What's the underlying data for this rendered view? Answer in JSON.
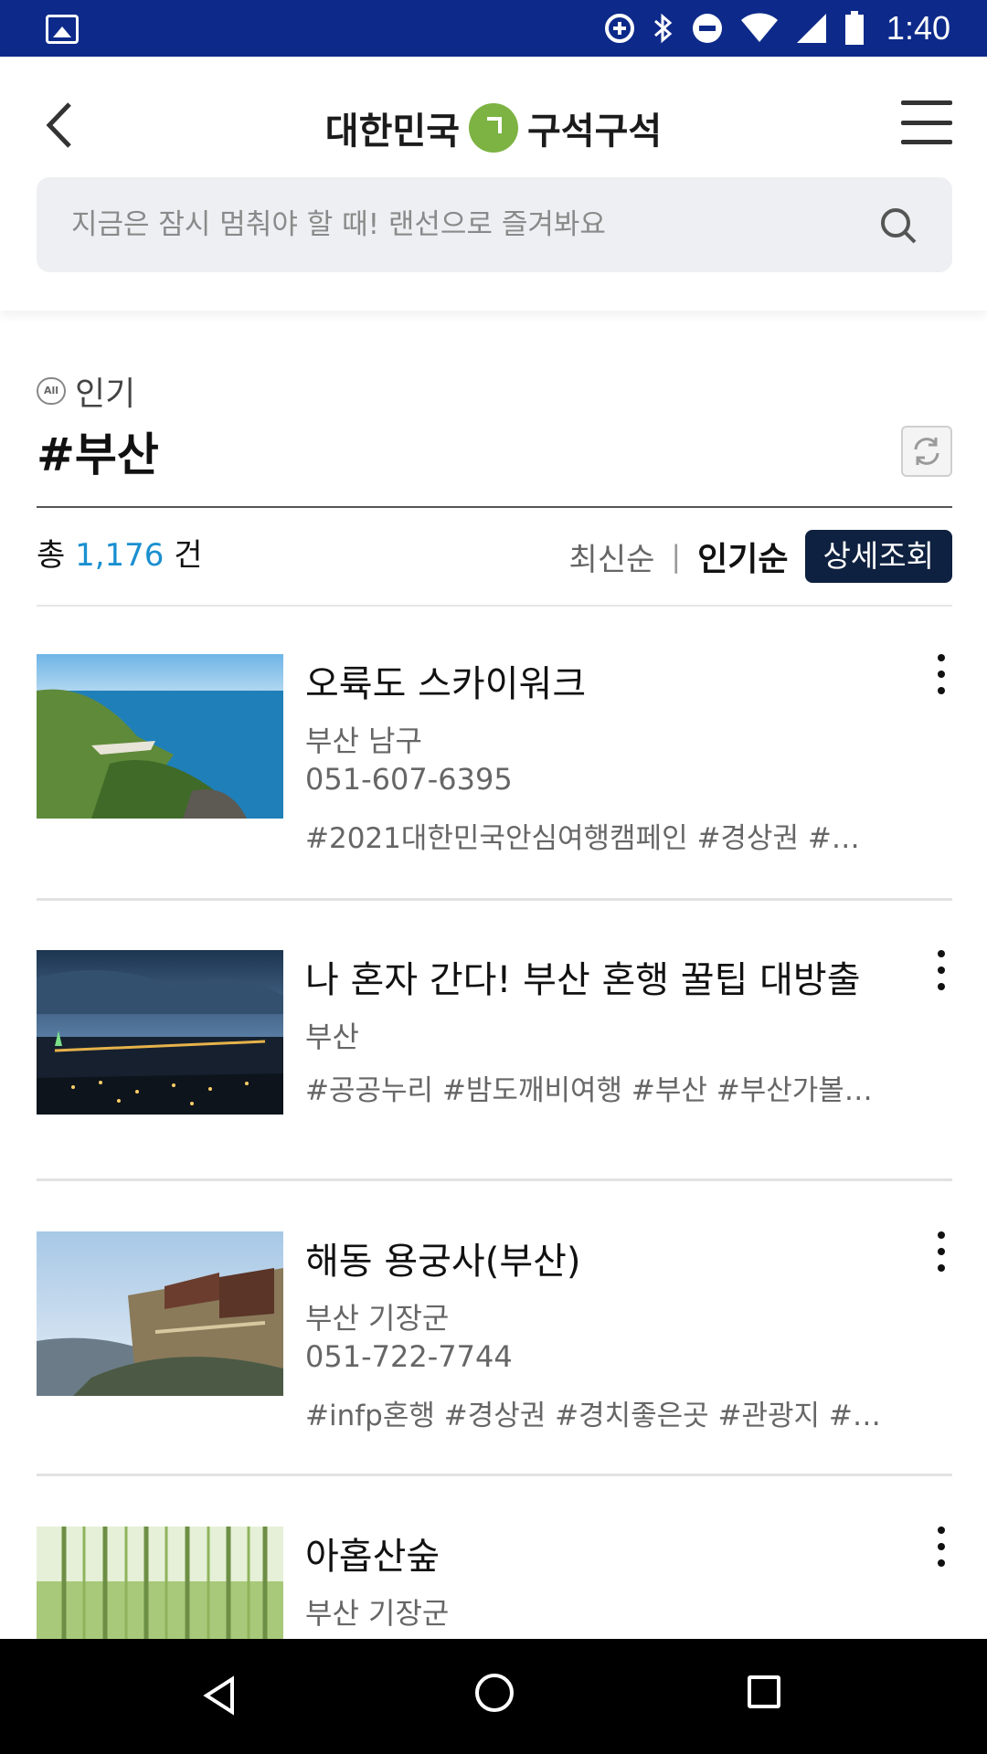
{
  "status_bar": {
    "time": "1:40",
    "icons": [
      "gallery-icon",
      "data-saver-icon",
      "bluetooth-icon",
      "do-not-disturb-icon",
      "wifi-icon",
      "signal-icon",
      "battery-icon"
    ]
  },
  "header": {
    "logo_left": "대한민국",
    "logo_right": "구석구석",
    "logo_color": "#7cb342",
    "search_placeholder": "지금은 잠시 멈춰야 할 때! 랜선으로 즐겨봐요"
  },
  "section": {
    "badge": "All",
    "label": "인기",
    "title": "#부산",
    "count_prefix": "총",
    "count_value": "1,176",
    "count_suffix": "건",
    "sort_latest": "최신순",
    "sort_separator": "|",
    "sort_popular": "인기순",
    "detail_button": "상세조회",
    "accent_color": "#1a8fd0",
    "button_color": "#0f2140"
  },
  "items": [
    {
      "title": "오륙도 스카이워크",
      "location": "부산 남구",
      "phone": "051-607-6395",
      "tags": "#2021대한민국안심여행캠페인  #경상권  #…"
    },
    {
      "title": "나 혼자 간다! 부산 혼행 꿀팁 대방출",
      "location": "부산",
      "tags": "#공공누리  #밤도깨비여행  #부산  #부산가볼…"
    },
    {
      "title": "해동 용궁사(부산)",
      "location": "부산 기장군",
      "phone": "051-722-7744",
      "tags": "#infp혼행  #경상권  #경치좋은곳  #관광지  #…"
    },
    {
      "title": "아홉산숲",
      "location": "부산 기장군"
    }
  ]
}
